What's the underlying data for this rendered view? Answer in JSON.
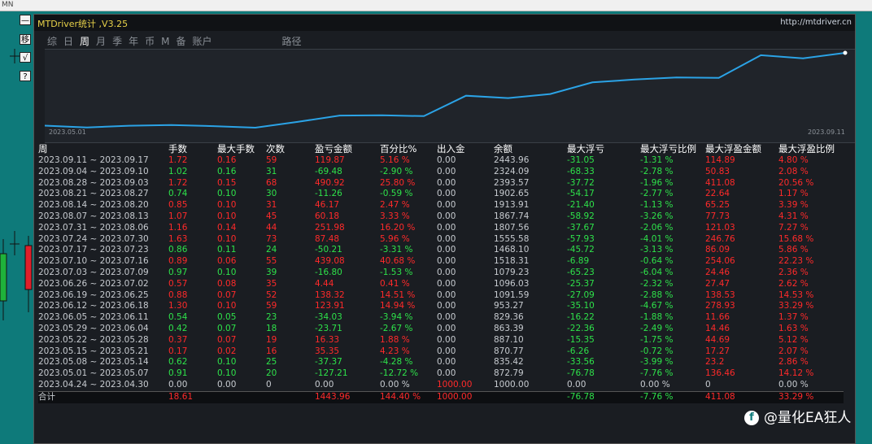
{
  "topbar": {
    "label": "MN"
  },
  "side_buttons": [
    {
      "label": "—",
      "icon": "minimize-icon"
    },
    {
      "label": "移",
      "icon": ""
    },
    {
      "label": "√",
      "icon": "check-icon"
    },
    {
      "label": "?",
      "icon": "help-icon"
    }
  ],
  "panel": {
    "title": "MTDriver统计 ,V3.25",
    "url": "http://mtdriver.cn"
  },
  "tabs": [
    "综",
    "日",
    "周",
    "月",
    "季",
    "年",
    "币",
    "M",
    "备",
    "账户",
    "路径"
  ],
  "active_tab": "周",
  "chart_data": {
    "type": "line",
    "x_start_label": "2023.05.01",
    "x_end_label": "2023.09.11",
    "line_color": "#2ba3e6",
    "values": [
      872.79,
      835.42,
      870.77,
      887.1,
      863.39,
      829.36,
      953.27,
      1091.59,
      1096.03,
      1079.23,
      1518.31,
      1468.1,
      1555.58,
      1807.56,
      1867.74,
      1913.91,
      1902.65,
      2393.57,
      2324.09,
      2443.96
    ]
  },
  "table": {
    "headers": [
      "周",
      "手数",
      "最大手数",
      "次数",
      "盈亏金额",
      "百分比%",
      "出入金",
      "余额",
      "最大浮亏",
      "最大浮亏比例",
      "最大浮盈金额",
      "最大浮盈比例"
    ],
    "rows": [
      [
        "2023.09.11 ~ 2023.09.17",
        "1.72",
        "0.16",
        "59",
        "119.87",
        "5.16 %",
        "0.00",
        "2443.96",
        "-31.05",
        "-1.31 %",
        "114.89",
        "4.80 %"
      ],
      [
        "2023.09.04 ~ 2023.09.10",
        "1.02",
        "0.16",
        "31",
        "-69.48",
        "-2.90 %",
        "0.00",
        "2324.09",
        "-68.33",
        "-2.78 %",
        "50.83",
        "2.08 %"
      ],
      [
        "2023.08.28 ~ 2023.09.03",
        "1.72",
        "0.15",
        "68",
        "490.92",
        "25.80 %",
        "0.00",
        "2393.57",
        "-37.72",
        "-1.96 %",
        "411.08",
        "20.56 %"
      ],
      [
        "2023.08.21 ~ 2023.08.27",
        "0.74",
        "0.10",
        "30",
        "-11.26",
        "-0.59 %",
        "0.00",
        "1902.65",
        "-54.17",
        "-2.77 %",
        "22.64",
        "1.17 %"
      ],
      [
        "2023.08.14 ~ 2023.08.20",
        "0.85",
        "0.10",
        "31",
        "46.17",
        "2.47 %",
        "0.00",
        "1913.91",
        "-21.40",
        "-1.13 %",
        "65.25",
        "3.39 %"
      ],
      [
        "2023.08.07 ~ 2023.08.13",
        "1.07",
        "0.10",
        "45",
        "60.18",
        "3.33 %",
        "0.00",
        "1867.74",
        "-58.92",
        "-3.26 %",
        "77.73",
        "4.31 %"
      ],
      [
        "2023.07.31 ~ 2023.08.06",
        "1.16",
        "0.14",
        "44",
        "251.98",
        "16.20 %",
        "0.00",
        "1807.56",
        "-37.67",
        "-2.06 %",
        "121.03",
        "7.27 %"
      ],
      [
        "2023.07.24 ~ 2023.07.30",
        "1.63",
        "0.10",
        "73",
        "87.48",
        "5.96 %",
        "0.00",
        "1555.58",
        "-57.93",
        "-4.01 %",
        "246.76",
        "15.68 %"
      ],
      [
        "2023.07.17 ~ 2023.07.23",
        "0.86",
        "0.11",
        "24",
        "-50.21",
        "-3.31 %",
        "0.00",
        "1468.10",
        "-45.72",
        "-3.13 %",
        "86.09",
        "5.86 %"
      ],
      [
        "2023.07.10 ~ 2023.07.16",
        "0.89",
        "0.06",
        "55",
        "439.08",
        "40.68 %",
        "0.00",
        "1518.31",
        "-6.89",
        "-0.64 %",
        "254.06",
        "22.23 %"
      ],
      [
        "2023.07.03 ~ 2023.07.09",
        "0.97",
        "0.10",
        "39",
        "-16.80",
        "-1.53 %",
        "0.00",
        "1079.23",
        "-65.23",
        "-6.04 %",
        "24.46",
        "2.36 %"
      ],
      [
        "2023.06.26 ~ 2023.07.02",
        "0.57",
        "0.08",
        "35",
        "4.44",
        "0.41 %",
        "0.00",
        "1096.03",
        "-25.37",
        "-2.32 %",
        "27.47",
        "2.62 %"
      ],
      [
        "2023.06.19 ~ 2023.06.25",
        "0.88",
        "0.07",
        "52",
        "138.32",
        "14.51 %",
        "0.00",
        "1091.59",
        "-27.09",
        "-2.88 %",
        "138.53",
        "14.53 %"
      ],
      [
        "2023.06.12 ~ 2023.06.18",
        "1.30",
        "0.10",
        "59",
        "123.91",
        "14.94 %",
        "0.00",
        "953.27",
        "-35.10",
        "-4.67 %",
        "278.93",
        "33.29 %"
      ],
      [
        "2023.06.05 ~ 2023.06.11",
        "0.54",
        "0.05",
        "23",
        "-34.03",
        "-3.94 %",
        "0.00",
        "829.36",
        "-16.22",
        "-1.88 %",
        "11.66",
        "1.37 %"
      ],
      [
        "2023.05.29 ~ 2023.06.04",
        "0.42",
        "0.07",
        "18",
        "-23.71",
        "-2.67 %",
        "0.00",
        "863.39",
        "-22.36",
        "-2.49 %",
        "14.46",
        "1.63 %"
      ],
      [
        "2023.05.22 ~ 2023.05.28",
        "0.37",
        "0.07",
        "19",
        "16.33",
        "1.88 %",
        "0.00",
        "887.10",
        "-15.35",
        "-1.75 %",
        "44.69",
        "5.12 %"
      ],
      [
        "2023.05.15 ~ 2023.05.21",
        "0.17",
        "0.02",
        "16",
        "35.35",
        "4.23 %",
        "0.00",
        "870.77",
        "-6.26",
        "-0.72 %",
        "17.27",
        "2.07 %"
      ],
      [
        "2023.05.08 ~ 2023.05.14",
        "0.62",
        "0.10",
        "25",
        "-37.37",
        "-4.28 %",
        "0.00",
        "835.42",
        "-33.56",
        "-3.99 %",
        "23.2",
        "2.86 %"
      ],
      [
        "2023.05.01 ~ 2023.05.07",
        "0.91",
        "0.10",
        "20",
        "-127.21",
        "-12.72 %",
        "0.00",
        "872.79",
        "-76.78",
        "-7.76 %",
        "136.46",
        "14.12 %"
      ],
      [
        "2023.04.24 ~ 2023.04.30",
        "0.00",
        "0.00",
        "0",
        "0.00",
        "0.00 %",
        "1000.00",
        "1000.00",
        "0.00",
        "0.00 %",
        "0",
        "0.00 %"
      ]
    ],
    "total": [
      "合计",
      "18.61",
      "",
      "",
      "1443.96",
      "144.40 %",
      "1000.00",
      "",
      "-76.78",
      "-7.76 %",
      "411.08",
      "33.29 %"
    ]
  },
  "watermark": "@量化EA狂人",
  "colors": {
    "positive": "#ff2a2a",
    "negative": "#2ee24a",
    "accent": "#2ba3e6",
    "title": "#e8d24a"
  }
}
